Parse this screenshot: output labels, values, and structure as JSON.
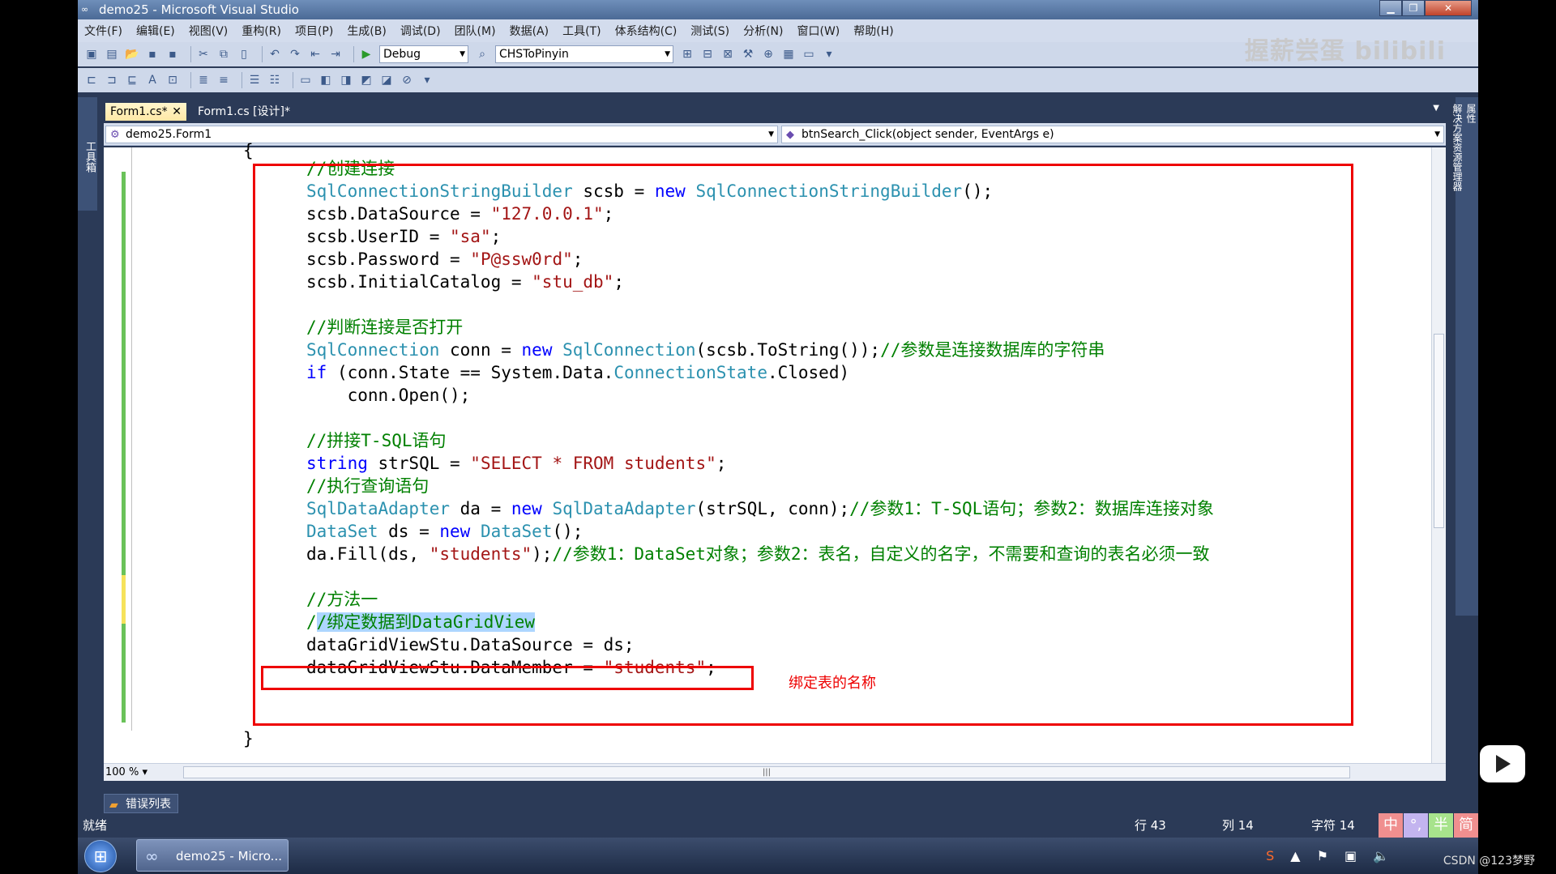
{
  "window": {
    "title": "demo25 - Microsoft Visual Studio"
  },
  "menu": [
    "文件(F)",
    "编辑(E)",
    "视图(V)",
    "重构(R)",
    "项目(P)",
    "生成(B)",
    "调试(D)",
    "团队(M)",
    "数据(A)",
    "工具(T)",
    "体系结构(C)",
    "测试(S)",
    "分析(N)",
    "窗口(W)",
    "帮助(H)"
  ],
  "toolbar": {
    "config": "Debug",
    "project": "CHSToPinyin"
  },
  "watermark": "握薪尝蛋 bilibili",
  "side_panels": {
    "left": "工具箱",
    "right_1": "属性",
    "right_2": "解决方案资源管理器"
  },
  "tabs": {
    "active": "Form1.cs*",
    "inactive": "Form1.cs [设计]*"
  },
  "nav": {
    "type": "demo25.Form1",
    "member": "btnSearch_Click(object sender, EventArgs e)"
  },
  "code": {
    "open_brace": "{",
    "close_brace": "}",
    "c1": "//创建连接",
    "l1_t1": "SqlConnectionStringBuilder",
    "l1_p1": " scsb = ",
    "l1_k1": "new",
    "l1_p2": " ",
    "l1_t2": "SqlConnectionStringBuilder",
    "l1_p3": "();",
    "l2_p": "scsb.DataSource = ",
    "l2_s": "\"127.0.0.1\"",
    "l3_p": "scsb.UserID = ",
    "l3_s": "\"sa\"",
    "l4_p": "scsb.Password = ",
    "l4_s": "\"P@ssw0rd\"",
    "l5_p": "scsb.InitialCatalog = ",
    "l5_s": "\"stu_db\"",
    "c2": "//判断连接是否打开",
    "l6_t1": "SqlConnection",
    "l6_p1": " conn = ",
    "l6_k1": "new",
    "l6_p2": " ",
    "l6_t2": "SqlConnection",
    "l6_p3": "(scsb.ToString());",
    "l6_c": "//参数是连接数据库的字符串",
    "l7_k": "if",
    "l7_p1": " (conn.State == System.Data.",
    "l7_t": "ConnectionState",
    "l7_p2": ".Closed)",
    "l8": "    conn.Open();",
    "c3": "//拼接T-SQL语句",
    "l9_k": "string",
    "l9_p": " strSQL = ",
    "l9_s": "\"SELECT * FROM students\"",
    "l9_e": ";",
    "c4": "//执行查询语句",
    "l10_t1": "SqlDataAdapter",
    "l10_p1": " da = ",
    "l10_k": "new",
    "l10_p2": " ",
    "l10_t2": "SqlDataAdapter",
    "l10_p3": "(strSQL, conn);",
    "l10_c": "//参数1：T-SQL语句；参数2：数据库连接对象",
    "l11_t1": "DataSet",
    "l11_p1": " ds = ",
    "l11_k": "new",
    "l11_p2": " ",
    "l11_t2": "DataSet",
    "l11_p3": "();",
    "l12_p1": "da.Fill(ds, ",
    "l12_s": "\"students\"",
    "l12_p2": ");",
    "l12_c": "//参数1：DataSet对象；参数2：表名，自定义的名字，不需要和查询的表名必须一致",
    "c5": "//方法一",
    "c6_a": "/",
    "c6_b": "/绑定数据到DataGridView",
    "l13": "dataGridViewStu.DataSource = ds;",
    "l14_p": "dataGridViewStu.DataMember = ",
    "l14_s": "\"students\"",
    "l14_e": ";"
  },
  "annotation": "绑定表的名称",
  "zoom": "100 %",
  "error_list": "错误列表",
  "status": {
    "ready": "就绪",
    "line": "行 43",
    "col": "列 14",
    "char": "字符 14"
  },
  "ime": [
    "中",
    "°,",
    "半",
    "简"
  ],
  "taskbar": {
    "item": "demo25 - Micro..."
  },
  "credit": "CSDN @123梦野",
  "colors": {
    "comment": "#008000",
    "type": "#2b91af",
    "keyword": "#0000ff",
    "string": "#a31515",
    "highlight_box": "#e00000"
  }
}
